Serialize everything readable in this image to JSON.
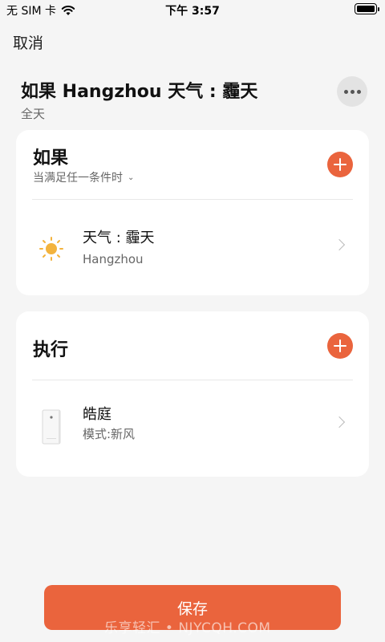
{
  "status_bar": {
    "carrier": "无 SIM 卡",
    "time": "下午 3:57"
  },
  "header": {
    "cancel_label": "取消",
    "title": "如果 Hangzhou 天气 : 霾天",
    "subtitle": "全天"
  },
  "if_card": {
    "heading": "如果",
    "condition_mode": "当满足任一条件时",
    "items": [
      {
        "icon": "sun-icon",
        "title": "天气 : 霾天",
        "subtitle": "Hangzhou"
      }
    ]
  },
  "do_card": {
    "heading": "执行",
    "items": [
      {
        "icon": "air-purifier-icon",
        "title": "皓庭",
        "subtitle": "模式:新风"
      }
    ]
  },
  "footer": {
    "save_label": "保存",
    "watermark": "乐享轻汇 • NJYCQH.COM"
  },
  "colors": {
    "accent": "#ea643d",
    "background": "#f5f5f5",
    "card": "#ffffff"
  }
}
